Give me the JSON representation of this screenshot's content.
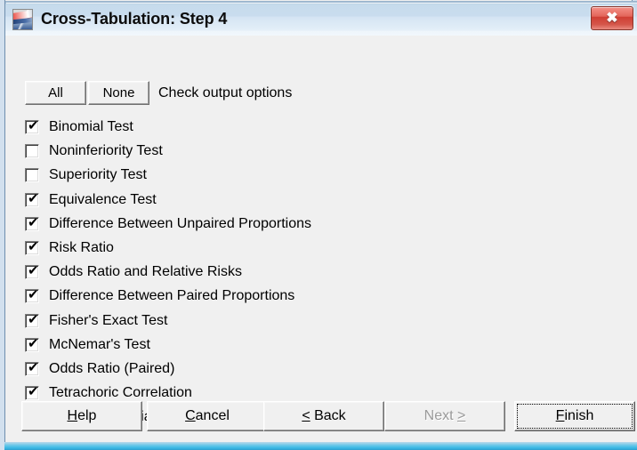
{
  "window": {
    "title": "Cross-Tabulation: Step 4",
    "icon": "app-icon",
    "close_label": "✖",
    "titlebar_color": "#c9dcee",
    "client_bg": "#f0f0f0",
    "close_button_color": "#d5564a",
    "glass_edge_color": "#39b7e4"
  },
  "toolbar": {
    "all_label": "All",
    "none_label": "None",
    "instruction": "Check output options"
  },
  "options": [
    {
      "label": "Binomial Test",
      "checked": true
    },
    {
      "label": "Noninferiority Test",
      "checked": false
    },
    {
      "label": "Superiority Test",
      "checked": false
    },
    {
      "label": "Equivalence Test",
      "checked": true
    },
    {
      "label": "Difference Between Unpaired Proportions",
      "checked": true
    },
    {
      "label": "Risk Ratio",
      "checked": true
    },
    {
      "label": "Odds Ratio and Relative Risks",
      "checked": true
    },
    {
      "label": "Difference Between Paired Proportions",
      "checked": true
    },
    {
      "label": "Fisher's Exact Test",
      "checked": true
    },
    {
      "label": "McNemar's Test",
      "checked": true
    },
    {
      "label": "Odds Ratio (Paired)",
      "checked": true
    },
    {
      "label": "Tetrachoric Correlation",
      "checked": true
    },
    {
      "label": "Statistics for Diagnostic Tests",
      "checked": true
    }
  ],
  "buttons": {
    "help": {
      "label": "Help",
      "accel": "H",
      "enabled": true,
      "focused": false
    },
    "cancel": {
      "label": "Cancel",
      "accel": "C",
      "enabled": true,
      "focused": false
    },
    "back": {
      "label": "< Back",
      "accel": "<",
      "enabled": true,
      "focused": false
    },
    "next": {
      "label": "Next >",
      "accel": ">",
      "enabled": false,
      "focused": false
    },
    "finish": {
      "label": "Finish",
      "accel": "F",
      "enabled": true,
      "focused": true
    }
  },
  "checkbox_glyph": "✔"
}
